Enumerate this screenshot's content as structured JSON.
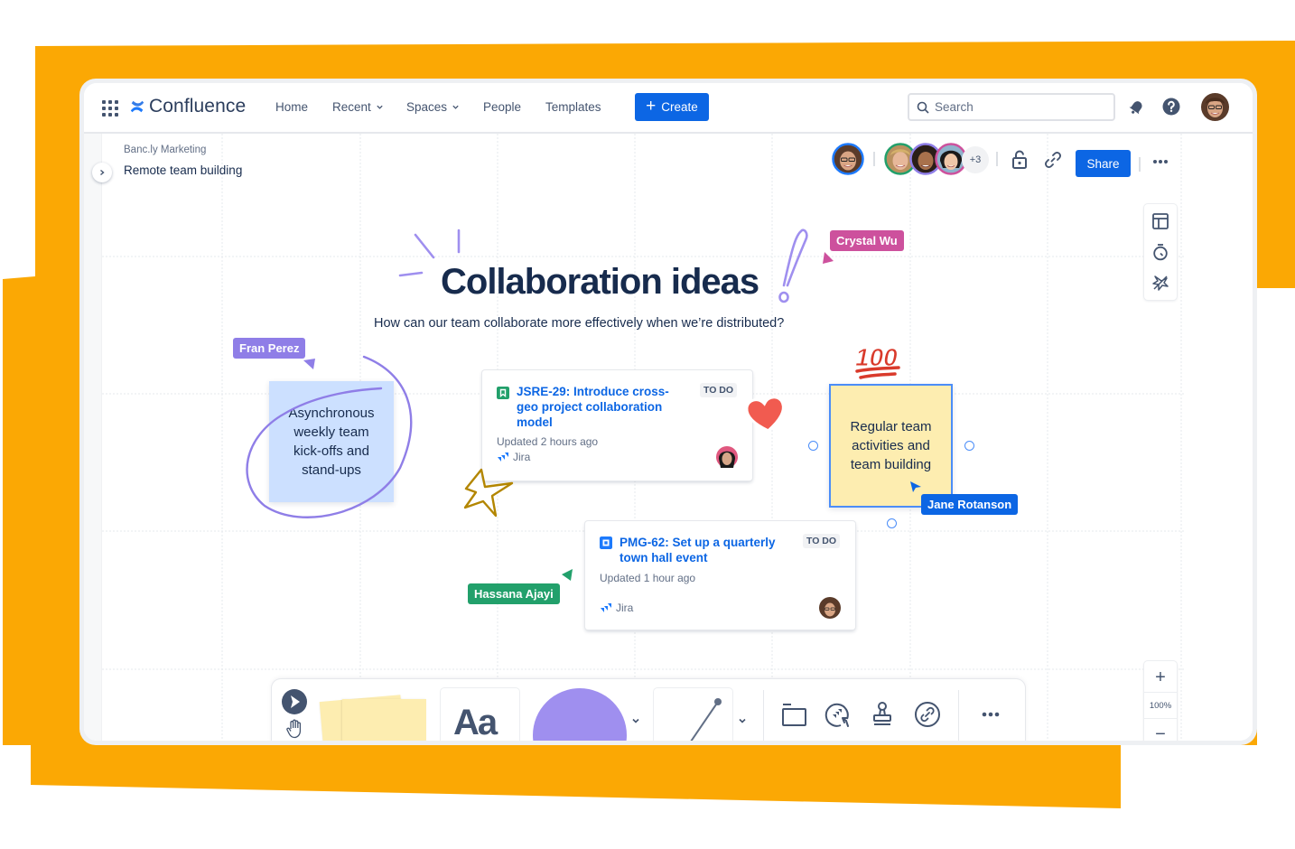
{
  "colors": {
    "orange_backdrop": "#FBA804",
    "brand_blue": "#0C66E4",
    "text_primary": "#172B4D",
    "text_secondary": "#626F86",
    "sticky_blue": "#CCE0FF",
    "sticky_yellow": "#FDEDB0",
    "purple_accent": "#9F8FEF"
  },
  "topnav": {
    "app_name": "Confluence",
    "items": [
      {
        "label": "Home",
        "has_dropdown": false
      },
      {
        "label": "Recent",
        "has_dropdown": true
      },
      {
        "label": "Spaces",
        "has_dropdown": true
      },
      {
        "label": "People",
        "has_dropdown": false
      },
      {
        "label": "Templates",
        "has_dropdown": false
      }
    ],
    "create_label": "Create",
    "search_placeholder": "Search",
    "icons": [
      "app-switcher-icon",
      "notification-bell-icon",
      "help-icon",
      "profile-avatar"
    ]
  },
  "page": {
    "space": "Banc.ly Marketing",
    "title": "Remote team building"
  },
  "collaborators": {
    "primary_avatar_color": "#1D7AFC",
    "group_avatar_colors": [
      "#22A06B",
      "#8F7EE7",
      "#CD519D"
    ],
    "more_count": "+3",
    "share_label": "Share"
  },
  "board": {
    "heading": "Collaboration ideas",
    "subheading": "How can our team collaborate more effectively when we’re distributed?",
    "cursors": [
      {
        "name": "Crystal Wu",
        "color": "#CD519D"
      },
      {
        "name": "Fran Perez",
        "color": "#8F7EE7"
      },
      {
        "name": "Jane Rotanson",
        "color": "#0C66E4"
      },
      {
        "name": "Hassana Ajayi",
        "color": "#22A06B"
      }
    ],
    "stickies": [
      {
        "text": "Asynchronous weekly team kick-offs and stand-ups",
        "color": "#CCE0FF"
      },
      {
        "text": "Regular team activities and team building",
        "color": "#FDEDB0",
        "selected": true
      }
    ],
    "jira_cards": [
      {
        "key_title": "JSRE-29: Introduce cross-geo project collaboration model",
        "status": "TO DO",
        "updated": "Updated 2 hours ago",
        "source": "Jira",
        "issue_type": "story",
        "type_color": "#22A06B"
      },
      {
        "key_title": "PMG-62: Set up a quarterly town hall event",
        "status": "TO DO",
        "updated": "Updated 1 hour ago",
        "source": "Jira",
        "issue_type": "task",
        "type_color": "#1D7AFC"
      }
    ],
    "stickers": [
      "heart-sticker",
      "hundred-points-sticker",
      "star-doodle",
      "exclamation-doodle",
      "sparkle-doodle",
      "circle-doodle"
    ]
  },
  "side_tools": [
    "templates-icon",
    "timer-icon",
    "reactions-icon"
  ],
  "zoom": {
    "level": "100%",
    "in_label": "+",
    "out_label": "−"
  },
  "toolbar": {
    "text_tool_label": "Aa",
    "tools": [
      "select-tool",
      "hand-tool",
      "sticky-note-tool",
      "text-tool",
      "shape-tool",
      "line-tool",
      "frame-tool",
      "jira-import-tool",
      "stamp-tool",
      "link-tool",
      "more-tools"
    ]
  }
}
